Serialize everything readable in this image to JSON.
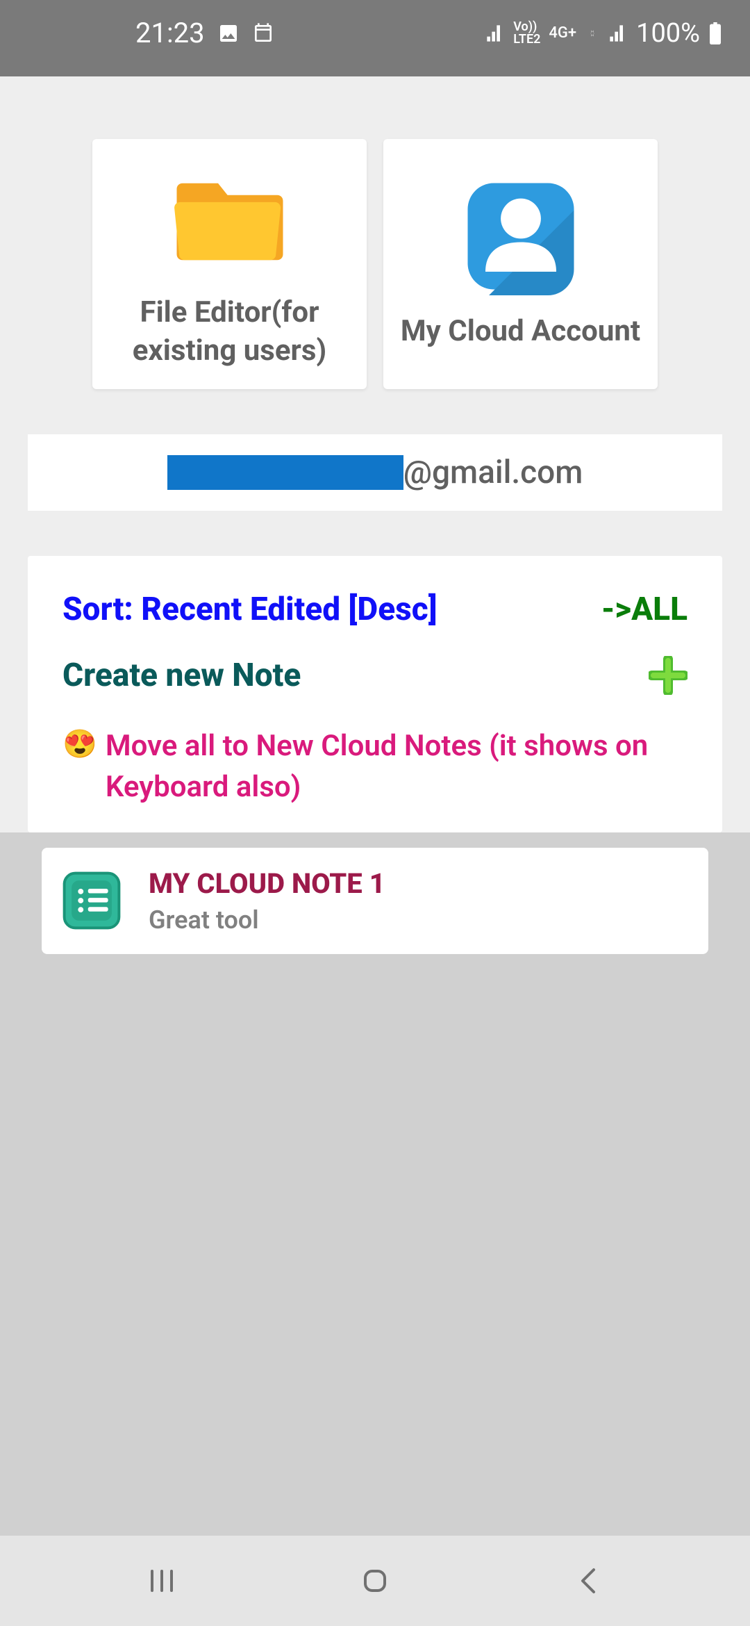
{
  "status": {
    "time": "21:23",
    "lte": "Vo)) LTE2",
    "network": "4G+",
    "battery": "100%"
  },
  "topCards": {
    "fileEditor": "File Editor(for existing users)",
    "cloudAccount": "My Cloud Account"
  },
  "email": {
    "domain": "@gmail.com"
  },
  "actions": {
    "sortLabel": "Sort: Recent Edited [Desc]",
    "allLabel": "->ALL",
    "createLabel": "Create new Note",
    "moveEmoji": "😍",
    "moveText": "Move all to New Cloud Notes (it shows on Keyboard also)"
  },
  "notes": [
    {
      "title": "MY CLOUD NOTE 1",
      "subtitle": "Great tool"
    }
  ]
}
